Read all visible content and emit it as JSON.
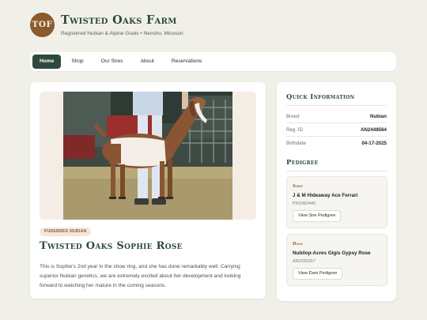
{
  "brand": {
    "logo_text": "TOF",
    "title": "Twisted Oaks Farm",
    "subtitle": "Registered Nubian & Alpine Goats • Neosho, Missouri",
    "logo_color": "#8b5a2b"
  },
  "nav": {
    "items": [
      {
        "label": "Home",
        "active": true
      },
      {
        "label": "Shop"
      },
      {
        "label": "Our Sires"
      },
      {
        "label": "About"
      },
      {
        "label": "Reservations"
      }
    ],
    "active_color": "#2f4a3d"
  },
  "goat": {
    "badge": "PUREBRED NUBIAN",
    "name": "Twisted Oaks Sophie Rose",
    "description": "This is Sophie's 2nd year in the show ring, and she has done remarkably well. Carrying superior Nubian genetics, we are extremely excited about her development and looking forward to watching her mature in the coming seasons."
  },
  "quick_info": {
    "title": "Quick Information",
    "rows": [
      {
        "label": "Breed",
        "value": "Nubian"
      },
      {
        "label": "Reg. ID",
        "value": "AN2448564"
      },
      {
        "label": "Birthdate",
        "value": "04-17-2025"
      }
    ]
  },
  "pedigree": {
    "title": "Pedigree",
    "sire": {
      "role": "Sire",
      "name": "J & M Hideaway Ace Ferrari",
      "reg": "PN2082440",
      "button": "View Sire Pedigree"
    },
    "dam": {
      "role": "Dam",
      "name": "Nubilop-Acres Gigis Gypsy Rose",
      "reg": "AN2030257",
      "button": "View Dam Pedigree"
    }
  },
  "colors": {
    "accent_green": "#2c4a3b",
    "accent_brown": "#8b5a2b",
    "background": "#f1f0e8"
  }
}
